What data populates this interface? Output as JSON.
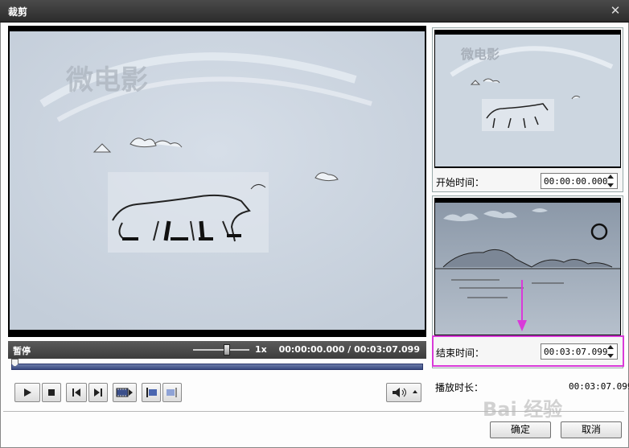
{
  "window": {
    "title": "裁剪",
    "close_glyph": "✕"
  },
  "player": {
    "state_label": "暂停",
    "speed_label": "1x",
    "speed_slider_fraction": 0.6,
    "time_readout": "00:00:00.000 / 00:03:07.099",
    "seek_position_fraction": 0.0,
    "video_overlay_text": "微电影"
  },
  "controls": {
    "play_icon": "play-icon",
    "stop_icon": "stop-icon",
    "prev_icon": "skip-back-icon",
    "next_icon": "skip-forward-icon",
    "frame_icon": "frame-step-icon",
    "mark_start_icon": "mark-in-icon",
    "mark_end_icon": "mark-out-icon",
    "volume_icon": "speaker-icon"
  },
  "start_pane": {
    "label": "开始时间：",
    "value": "00:00:00.000"
  },
  "end_pane": {
    "label": "结束时间：",
    "value": "00:03:07.099"
  },
  "duration": {
    "label": "播放时长：",
    "value": "00:03:07.099"
  },
  "buttons": {
    "ok": "确定",
    "cancel": "取消"
  },
  "watermark": "Bai 经验",
  "colors": {
    "highlight": "#d93ad9",
    "annotation_arrow": "#d93ad9",
    "seek_track": "#394a80"
  }
}
